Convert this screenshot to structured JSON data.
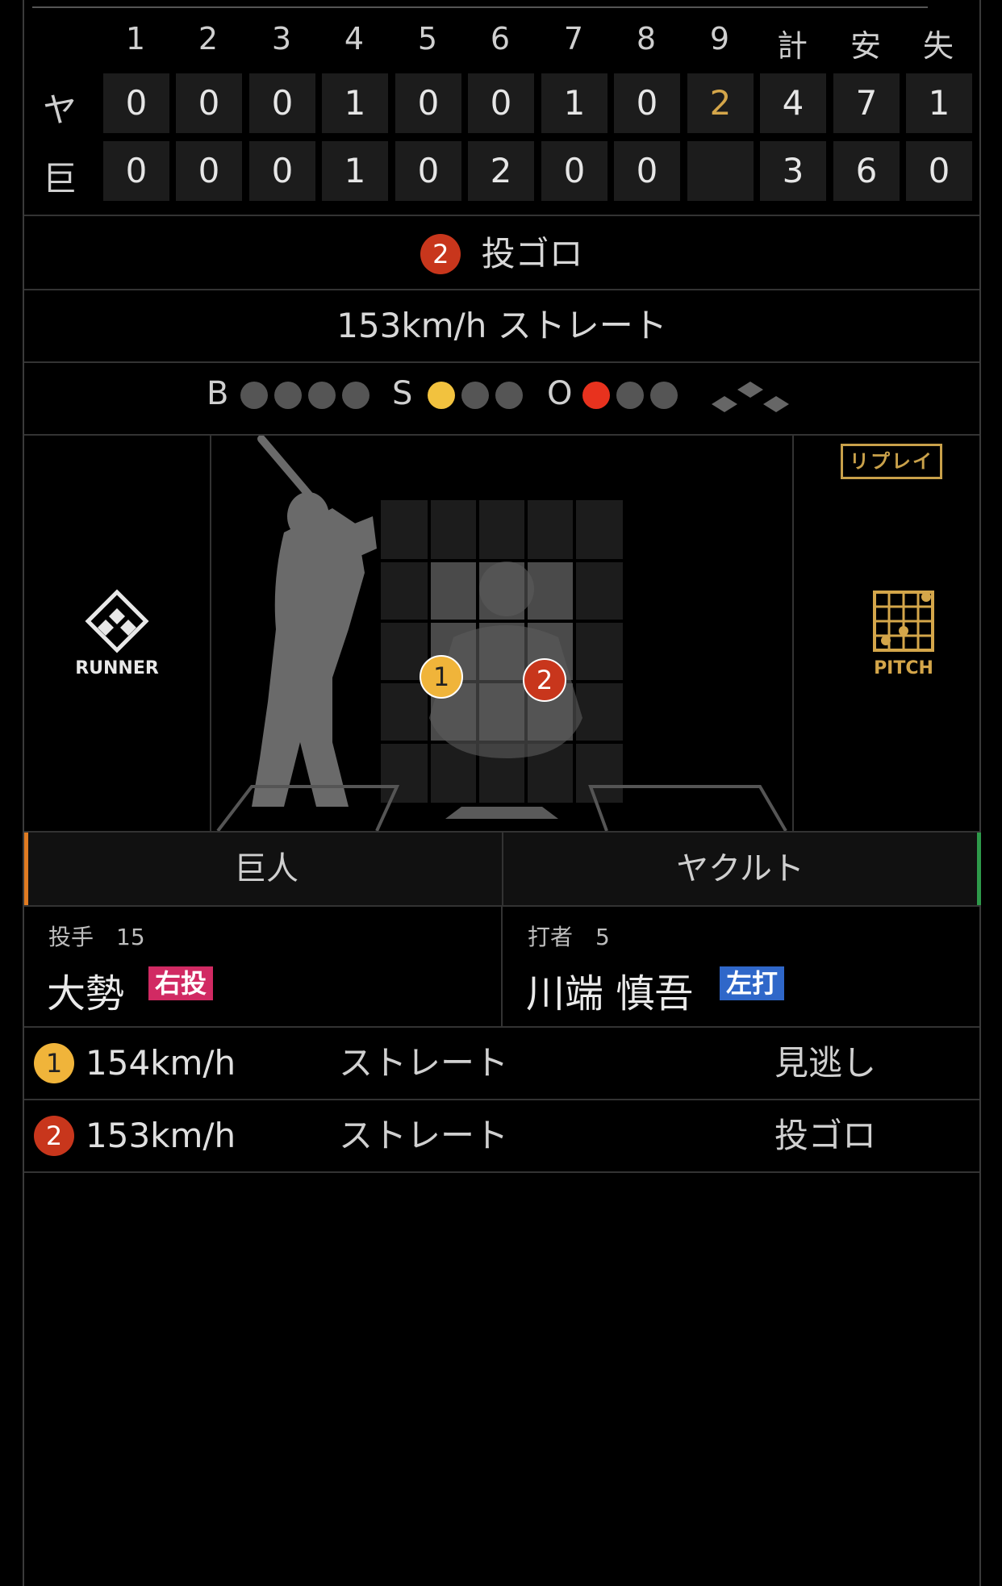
{
  "scoreboard": {
    "headers": [
      "1",
      "2",
      "3",
      "4",
      "5",
      "6",
      "7",
      "8",
      "9",
      "計",
      "安",
      "失"
    ],
    "rows": [
      {
        "team": "ヤ",
        "cells": [
          "0",
          "0",
          "0",
          "1",
          "0",
          "0",
          "1",
          "0",
          "2",
          "4",
          "7",
          "1"
        ]
      },
      {
        "team": "巨",
        "cells": [
          "0",
          "0",
          "0",
          "1",
          "0",
          "2",
          "0",
          "0",
          "",
          "3",
          "6",
          "0"
        ]
      }
    ]
  },
  "result": {
    "badge": "2",
    "text": "投ゴロ"
  },
  "pitch_info": "153km/h ストレート",
  "count": {
    "b_label": "B",
    "s_label": "S",
    "o_label": "O",
    "balls": 0,
    "strikes": 1,
    "outs": 1
  },
  "replay_label": "リプレイ",
  "runner_label": "RUNNER",
  "pitch_label": "PITCH",
  "zone_markers": [
    {
      "num": "1",
      "color": "#f0b43a"
    },
    {
      "num": "2",
      "color": "#c8361c"
    }
  ],
  "teams": {
    "left": "巨人",
    "right": "ヤクルト"
  },
  "pitcher": {
    "label": "投手　15",
    "name": "大勢",
    "tag": "右投"
  },
  "batter": {
    "label": "打者　5",
    "name": "川端 慎吾",
    "tag": "左打"
  },
  "pitches": [
    {
      "num": "1",
      "speed": "154km/h",
      "type": "ストレート",
      "result": "見逃し"
    },
    {
      "num": "2",
      "speed": "153km/h",
      "type": "ストレート",
      "result": "投ゴロ"
    }
  ],
  "colors": {
    "accent_gold": "#d4a64a",
    "right_hand": "#d12a63",
    "left_hand": "#2f67c9",
    "giants": "#e07b22",
    "swallows": "#2e9a4a"
  }
}
